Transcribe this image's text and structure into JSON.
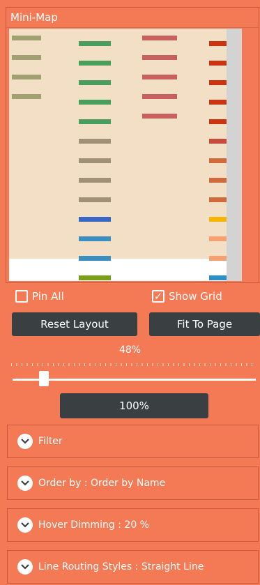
{
  "minimap": {
    "title": "Mini-Map",
    "colors": {
      "olive": "#a0a070",
      "green": "#4a9e5c",
      "taupe": "#a09078",
      "blue": "#3a66c8",
      "teal": "#3a8ec0",
      "lime": "#79a017",
      "rose": "#c86060",
      "red": "#cc3311",
      "brick": "#c84a3a",
      "orange": "#d06a3a",
      "yellow": "#f7b500",
      "peach": "#f7a070",
      "sky": "#2a90c8",
      "background": "#f2dfc5"
    }
  },
  "controls": {
    "pin_all_label": "Pin All",
    "pin_all_checked": false,
    "show_grid_label": "Show Grid",
    "show_grid_checked": true,
    "check_glyph": "✓",
    "reset_layout_label": "Reset Layout",
    "fit_to_page_label": "Fit To Page",
    "zoom_percent": "48%",
    "zoom_fraction": 0.1,
    "reset_zoom_label": "100%"
  },
  "accordions": [
    {
      "label": "Filter"
    },
    {
      "label": "Order by :  Order by Name"
    },
    {
      "label": "Hover Dimming :  20 %"
    },
    {
      "label": "Line Routing Styles :  Straight Line"
    }
  ],
  "icons": {
    "expand": "chevron-down-icon"
  }
}
